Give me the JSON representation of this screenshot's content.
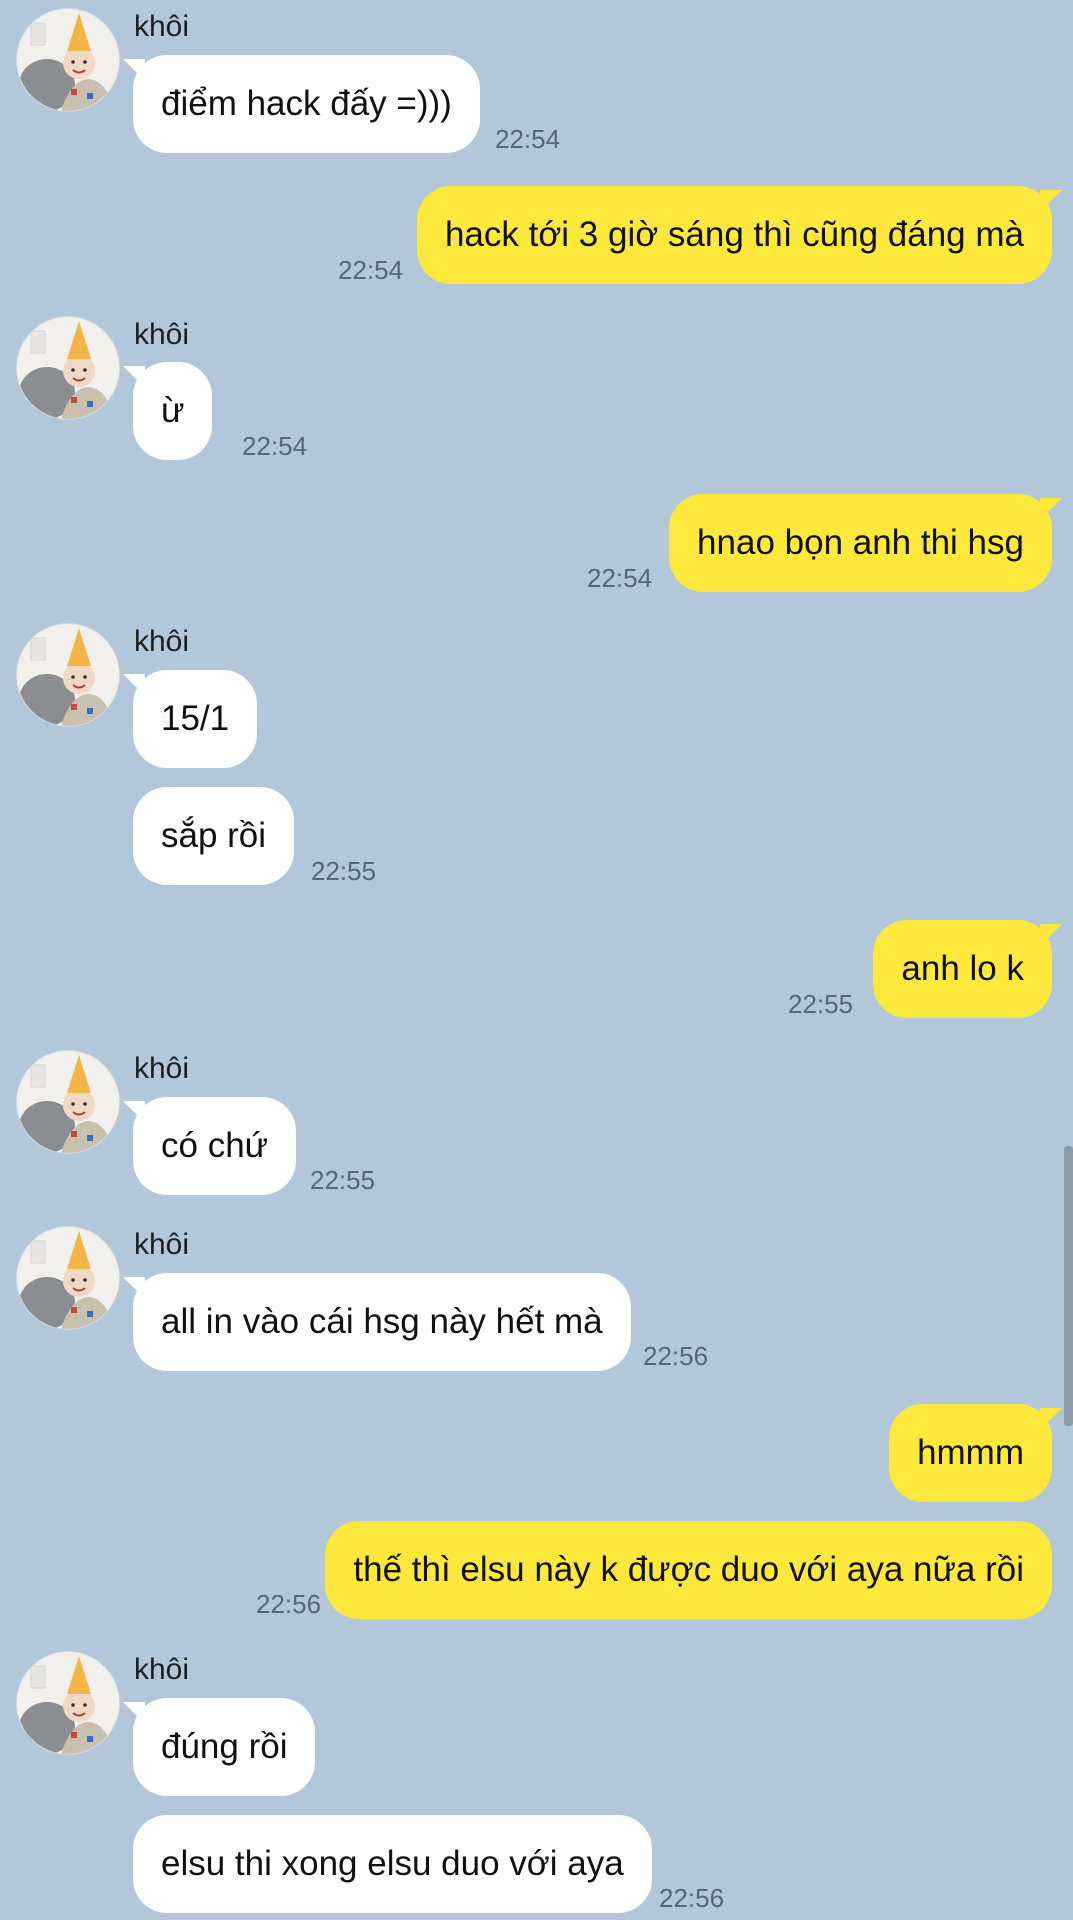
{
  "contact": {
    "name": "khôi"
  },
  "colors": {
    "background": "#b2c7da",
    "incoming_bubble": "#ffffff",
    "outgoing_bubble": "#fee83b",
    "timestamp": "#596673"
  },
  "messages": [
    {
      "direction": "incoming",
      "sender": "khôi",
      "text": "điểm hack đấy =)))",
      "time": "22:54"
    },
    {
      "direction": "outgoing",
      "text": "hack tới 3 giờ sáng thì cũng đáng mà",
      "time": "22:54"
    },
    {
      "direction": "incoming",
      "sender": "khôi",
      "text": "ừ",
      "time": "22:54"
    },
    {
      "direction": "outgoing",
      "text": "hnao bọn anh thi hsg",
      "time": "22:54"
    },
    {
      "direction": "incoming",
      "sender": "khôi",
      "text": "15/1",
      "time": ""
    },
    {
      "direction": "incoming",
      "text": "sắp rồi",
      "time": "22:55"
    },
    {
      "direction": "outgoing",
      "text": "anh lo k",
      "time": "22:55"
    },
    {
      "direction": "incoming",
      "sender": "khôi",
      "text": "có chứ",
      "time": "22:55"
    },
    {
      "direction": "incoming",
      "sender": "khôi",
      "text": "all in vào cái hsg này hết mà",
      "time": "22:56"
    },
    {
      "direction": "outgoing",
      "text": "hmmm",
      "time": ""
    },
    {
      "direction": "outgoing",
      "text": "thế thì elsu này k được duo với aya nữa rồi",
      "time": "22:56"
    },
    {
      "direction": "incoming",
      "sender": "khôi",
      "text": "đúng rồi",
      "time": ""
    },
    {
      "direction": "incoming",
      "text": "elsu thi xong elsu duo với aya",
      "time": "22:56"
    }
  ]
}
